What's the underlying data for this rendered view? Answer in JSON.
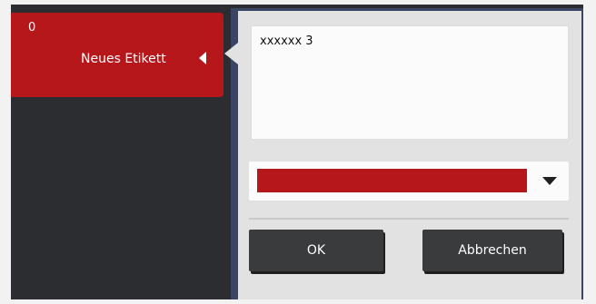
{
  "label_card": {
    "count": "0",
    "name": "Neues Etikett"
  },
  "editor": {
    "text_value": "xxxxxx 3",
    "selected_color": "#b5171b",
    "ok_label": "OK",
    "cancel_label": "Abbrechen"
  },
  "icons": {
    "card_collapse": "caret-left-icon",
    "dropdown": "caret-down-icon"
  }
}
